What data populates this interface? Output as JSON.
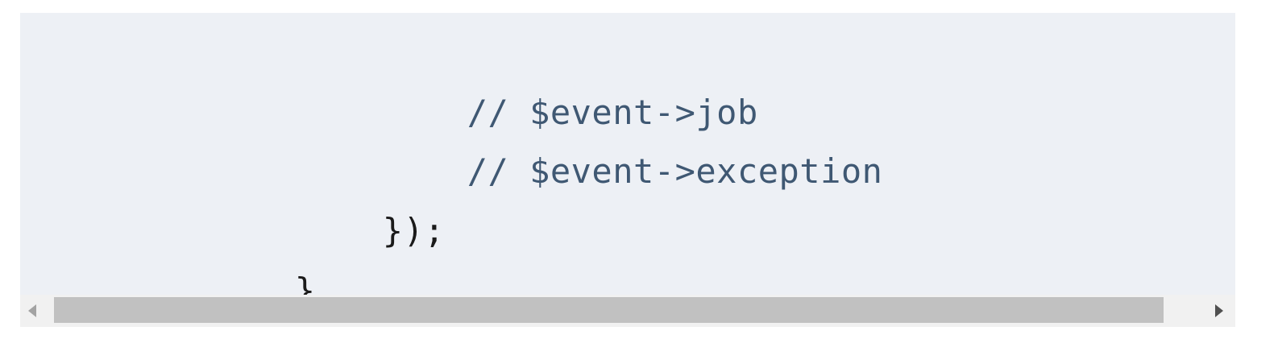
{
  "code_block": {
    "lines": [
      {
        "indent": "        ",
        "text": "// $event->job",
        "kind": "comment"
      },
      {
        "indent": "        ",
        "text": "// $event->exception",
        "kind": "comment"
      },
      {
        "indent": "      ",
        "text": "});",
        "kind": "punct"
      },
      {
        "indent": "    ",
        "text": "}",
        "kind": "punct"
      }
    ]
  },
  "scrollbar": {
    "position": 0.0,
    "visible_fraction": 0.94,
    "left_arrow_icon": "triangle-left-icon",
    "right_arrow_icon": "triangle-right-icon"
  },
  "colors": {
    "background": "#edf0f5",
    "comment": "#3f5873",
    "punctuation": "#1a1a1a",
    "scrollbar_track": "#f1f1f1",
    "scrollbar_thumb": "#c1c1c1"
  }
}
